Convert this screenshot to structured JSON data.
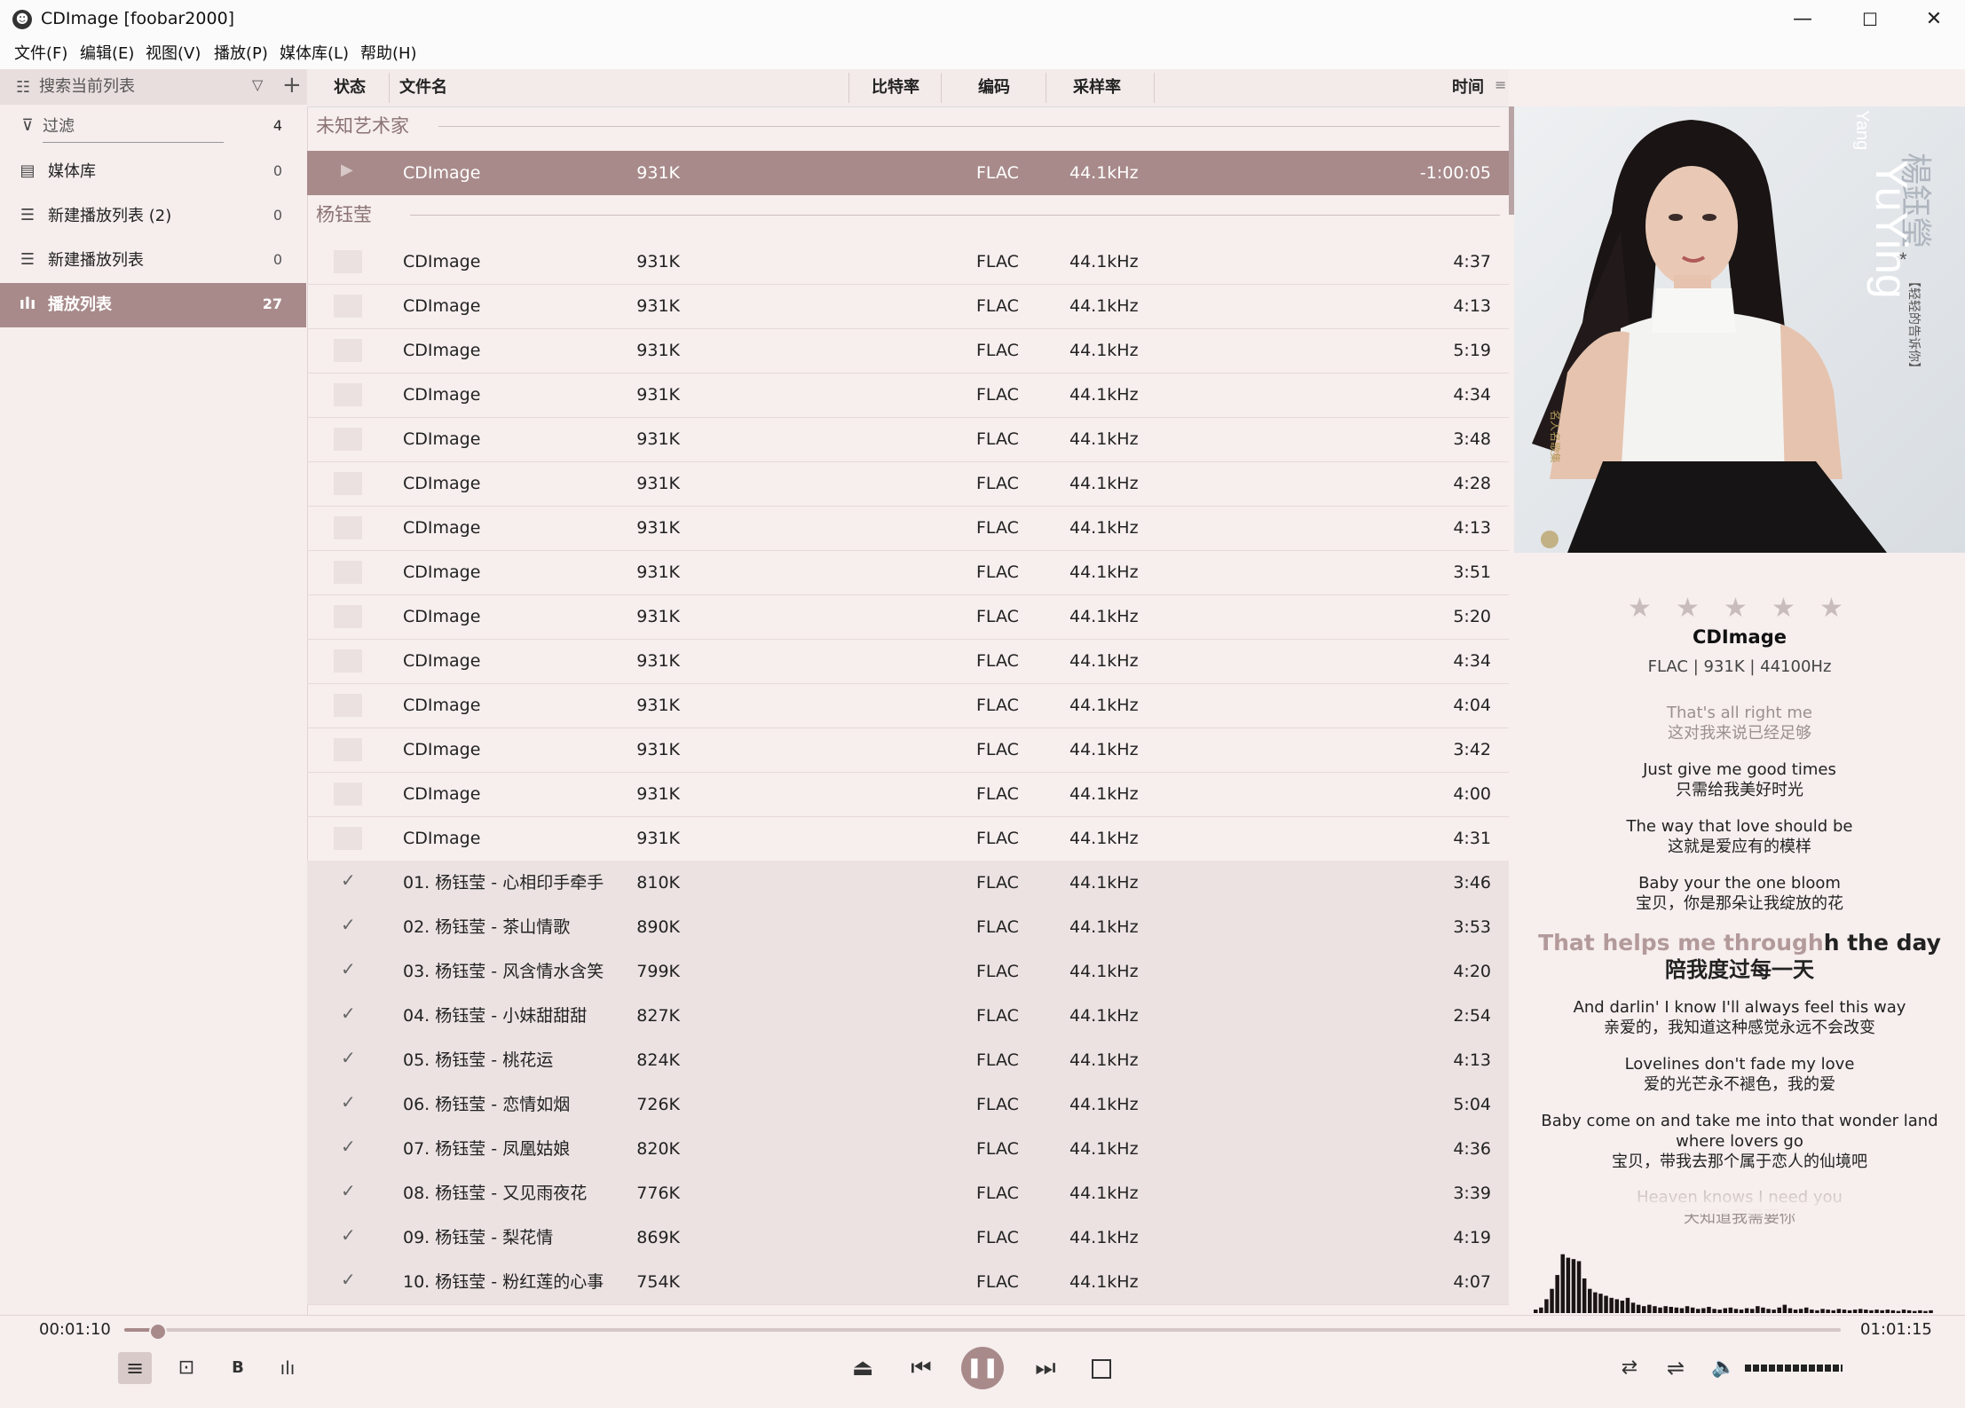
{
  "window": {
    "title": "CDImage  [foobar2000]",
    "controls": {
      "minimize": "—",
      "maximize": "☐",
      "close": "✕"
    }
  },
  "menu": [
    "文件(F)",
    "编辑(E)",
    "视图(V)",
    "播放(P)",
    "媒体库(L)",
    "帮助(H)"
  ],
  "left_panel": {
    "search_placeholder": "搜索当前列表",
    "filter": {
      "label": "过滤",
      "count": "4"
    },
    "items": [
      {
        "label": "媒体库",
        "count": "0",
        "icon": "library-icon"
      },
      {
        "label": "新建播放列表 (2)",
        "count": "0",
        "icon": "list-icon"
      },
      {
        "label": "新建播放列表",
        "count": "0",
        "icon": "list-icon"
      },
      {
        "label": "播放列表",
        "count": "27",
        "icon": "equalizer-icon",
        "active": true
      }
    ]
  },
  "playlist": {
    "columns": {
      "status": "状态",
      "filename": "文件名",
      "bitrate": "比特率",
      "codec": "编码",
      "samplerate": "采样率",
      "time": "时间"
    },
    "groups": [
      {
        "name": "未知艺术家",
        "rows": [
          {
            "name": "CDImage",
            "bitrate": "931K",
            "codec": "FLAC",
            "samplerate": "44.1kHz",
            "time": "-1:00:05",
            "state": "playing"
          }
        ]
      },
      {
        "name": "杨钰莹",
        "rows": [
          {
            "name": "CDImage",
            "bitrate": "931K",
            "codec": "FLAC",
            "samplerate": "44.1kHz",
            "time": "4:37",
            "state": "normal"
          },
          {
            "name": "CDImage",
            "bitrate": "931K",
            "codec": "FLAC",
            "samplerate": "44.1kHz",
            "time": "4:13",
            "state": "normal"
          },
          {
            "name": "CDImage",
            "bitrate": "931K",
            "codec": "FLAC",
            "samplerate": "44.1kHz",
            "time": "5:19",
            "state": "normal"
          },
          {
            "name": "CDImage",
            "bitrate": "931K",
            "codec": "FLAC",
            "samplerate": "44.1kHz",
            "time": "4:34",
            "state": "normal"
          },
          {
            "name": "CDImage",
            "bitrate": "931K",
            "codec": "FLAC",
            "samplerate": "44.1kHz",
            "time": "3:48",
            "state": "normal"
          },
          {
            "name": "CDImage",
            "bitrate": "931K",
            "codec": "FLAC",
            "samplerate": "44.1kHz",
            "time": "4:28",
            "state": "normal"
          },
          {
            "name": "CDImage",
            "bitrate": "931K",
            "codec": "FLAC",
            "samplerate": "44.1kHz",
            "time": "4:13",
            "state": "normal"
          },
          {
            "name": "CDImage",
            "bitrate": "931K",
            "codec": "FLAC",
            "samplerate": "44.1kHz",
            "time": "3:51",
            "state": "normal"
          },
          {
            "name": "CDImage",
            "bitrate": "931K",
            "codec": "FLAC",
            "samplerate": "44.1kHz",
            "time": "5:20",
            "state": "normal"
          },
          {
            "name": "CDImage",
            "bitrate": "931K",
            "codec": "FLAC",
            "samplerate": "44.1kHz",
            "time": "4:34",
            "state": "normal"
          },
          {
            "name": "CDImage",
            "bitrate": "931K",
            "codec": "FLAC",
            "samplerate": "44.1kHz",
            "time": "4:04",
            "state": "normal"
          },
          {
            "name": "CDImage",
            "bitrate": "931K",
            "codec": "FLAC",
            "samplerate": "44.1kHz",
            "time": "3:42",
            "state": "normal"
          },
          {
            "name": "CDImage",
            "bitrate": "931K",
            "codec": "FLAC",
            "samplerate": "44.1kHz",
            "time": "4:00",
            "state": "normal"
          },
          {
            "name": "CDImage",
            "bitrate": "931K",
            "codec": "FLAC",
            "samplerate": "44.1kHz",
            "time": "4:31",
            "state": "normal"
          },
          {
            "name": "01. 杨钰莹 - 心相印手牵手",
            "bitrate": "810K",
            "codec": "FLAC",
            "samplerate": "44.1kHz",
            "time": "3:46",
            "state": "done"
          },
          {
            "name": "02. 杨钰莹 - 茶山情歌",
            "bitrate": "890K",
            "codec": "FLAC",
            "samplerate": "44.1kHz",
            "time": "3:53",
            "state": "done"
          },
          {
            "name": "03. 杨钰莹 - 风含情水含笑",
            "bitrate": "799K",
            "codec": "FLAC",
            "samplerate": "44.1kHz",
            "time": "4:20",
            "state": "done"
          },
          {
            "name": "04. 杨钰莹 - 小妹甜甜甜",
            "bitrate": "827K",
            "codec": "FLAC",
            "samplerate": "44.1kHz",
            "time": "2:54",
            "state": "done"
          },
          {
            "name": "05. 杨钰莹 - 桃花运",
            "bitrate": "824K",
            "codec": "FLAC",
            "samplerate": "44.1kHz",
            "time": "4:13",
            "state": "done"
          },
          {
            "name": "06. 杨钰莹 - 恋情如烟",
            "bitrate": "726K",
            "codec": "FLAC",
            "samplerate": "44.1kHz",
            "time": "5:04",
            "state": "done"
          },
          {
            "name": "07. 杨钰莹 - 凤凰姑娘",
            "bitrate": "820K",
            "codec": "FLAC",
            "samplerate": "44.1kHz",
            "time": "4:36",
            "state": "done"
          },
          {
            "name": "08. 杨钰莹 - 又见雨夜花",
            "bitrate": "776K",
            "codec": "FLAC",
            "samplerate": "44.1kHz",
            "time": "3:39",
            "state": "done"
          },
          {
            "name": "09. 杨钰莹 - 梨花情",
            "bitrate": "869K",
            "codec": "FLAC",
            "samplerate": "44.1kHz",
            "time": "4:19",
            "state": "done"
          },
          {
            "name": "10. 杨钰莹 - 粉红莲的心事",
            "bitrate": "754K",
            "codec": "FLAC",
            "samplerate": "44.1kHz",
            "time": "4:07",
            "state": "done"
          }
        ]
      }
    ]
  },
  "now_playing": {
    "album_art_text": {
      "cn_name": "楊鈺瑩",
      "en_name": "YuYing",
      "en_surname": "Yang",
      "subtitle": "【轻轻的告诉你】",
      "star": "*",
      "badge": "名人名歌集"
    },
    "rating_stars": 5,
    "rating_value": 0,
    "title": "CDImage",
    "info": "FLAC | 931K | 44100Hz",
    "lyrics": [
      {
        "en": "That's all right me",
        "cn": "这对我来说已经足够",
        "state": "past"
      },
      {
        "en": "Just give me good times",
        "cn": "只需给我美好时光",
        "state": "normal"
      },
      {
        "en": "The way that love should be",
        "cn": "这就是爱应有的模样",
        "state": "normal"
      },
      {
        "en": "Baby your the one bloom",
        "cn": "宝贝，你是那朵让我绽放的花",
        "state": "normal"
      },
      {
        "en_sung": "That helps me through",
        "en_rest": "h the day",
        "cn": "陪我度过每一天",
        "state": "current"
      },
      {
        "en": "And darlin' I know I'll always feel this way",
        "cn": "亲爱的，我知道这种感觉永远不会改变",
        "state": "normal"
      },
      {
        "en": "Lovelines don't fade my love",
        "cn": "爱的光芒永不褪色，我的爱",
        "state": "normal"
      },
      {
        "en": "Baby come on and take me into that wonder land where lovers go",
        "cn": "宝贝，带我去那个属于恋人的仙境吧",
        "state": "normal"
      },
      {
        "en": "Heaven knows I need you",
        "cn": "天知道我需要你",
        "state": "fading"
      }
    ],
    "spectrum_levels": [
      0.05,
      0.08,
      0.2,
      0.35,
      0.55,
      0.85,
      0.8,
      0.78,
      0.75,
      0.5,
      0.35,
      0.3,
      0.28,
      0.25,
      0.22,
      0.2,
      0.18,
      0.22,
      0.15,
      0.12,
      0.1,
      0.12,
      0.1,
      0.08,
      0.1,
      0.09,
      0.08,
      0.07,
      0.1,
      0.08,
      0.06,
      0.07,
      0.09,
      0.06,
      0.05,
      0.07,
      0.08,
      0.06,
      0.05,
      0.07,
      0.06,
      0.1,
      0.08,
      0.06,
      0.05,
      0.08,
      0.12,
      0.07,
      0.05,
      0.06,
      0.08,
      0.05,
      0.04,
      0.06,
      0.05,
      0.04,
      0.06,
      0.05,
      0.04,
      0.05,
      0.06,
      0.05,
      0.04,
      0.05,
      0.04,
      0.05,
      0.04,
      0.03,
      0.05,
      0.04,
      0.03,
      0.04,
      0.03,
      0.04
    ]
  },
  "transport": {
    "position": "00:01:10",
    "duration": "01:01:15",
    "progress": 0.019,
    "volume": 1.0,
    "icons": {
      "mode1": "≡",
      "mode2": "⊡",
      "mode3": "B",
      "mode4": "ılı",
      "eject": "⏏",
      "prev": "⏮",
      "pause": "❚❚",
      "next": "⏭",
      "shuffle": "⇄",
      "repeat": "⇌",
      "volume": "🔈"
    }
  },
  "colors": {
    "accent": "#a88a8a",
    "background": "#f7eeee",
    "group_text": "#8b7373"
  }
}
